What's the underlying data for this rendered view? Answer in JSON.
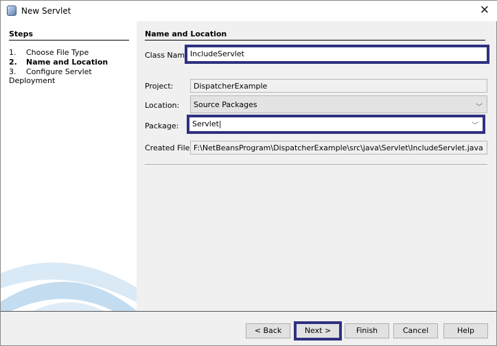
{
  "window": {
    "title": "New Servlet",
    "close_icon": "close-icon"
  },
  "steps": {
    "heading": "Steps",
    "items": [
      {
        "num": "1.",
        "label": "Choose File Type",
        "current": false
      },
      {
        "num": "2.",
        "label": "Name and Location",
        "current": true
      },
      {
        "num": "3.",
        "label": "Configure Servlet Deployment",
        "current": false
      }
    ]
  },
  "form": {
    "heading": "Name and Location",
    "class_name": {
      "label": "Class Name:",
      "value": "IncludeServlet"
    },
    "project": {
      "label": "Project:",
      "value": "DispatcherExample"
    },
    "location": {
      "label": "Location:",
      "value": "Source Packages"
    },
    "package": {
      "label": "Package:",
      "value": "Servlet"
    },
    "created_file": {
      "label": "Created File:",
      "value": "F:\\NetBeansProgram\\DispatcherExample\\src\\java\\Servlet\\IncludeServlet.java"
    }
  },
  "buttons": {
    "back": "< Back",
    "next": "Next >",
    "finish": "Finish",
    "cancel": "Cancel",
    "help": "Help"
  },
  "colors": {
    "highlight": "#2e3180"
  }
}
